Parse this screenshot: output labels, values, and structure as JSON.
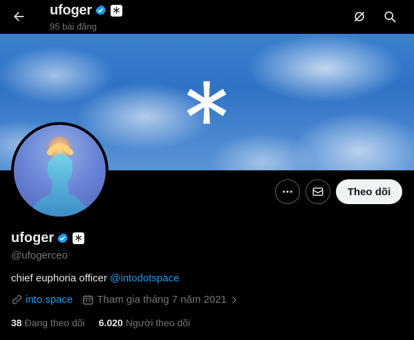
{
  "header": {
    "name": "ufoger",
    "post_count": "95 bài đăng",
    "icons": [
      "back-arrow-icon",
      "grok-icon",
      "search-icon"
    ]
  },
  "banner": {
    "colors": {
      "sky": "#2f73c6",
      "cloud": "#ffffff"
    }
  },
  "actions": {
    "more_icon": "more-icon",
    "message_icon": "envelope-icon",
    "follow_label": "Theo dõi"
  },
  "profile": {
    "name": "ufoger",
    "handle": "@ufogerceo",
    "bio_text": "chief euphoria officer ",
    "bio_mention": "@intodotspace",
    "website": "into.space",
    "joined": "Tham gia tháng 7 năm 2021",
    "following_count": "38",
    "following_label": "Đang theo dõi",
    "followers_count": "6.020",
    "followers_label": "Người theo dõi"
  },
  "colors": {
    "accent": "#1d9bf0",
    "secondary_text": "#71767b",
    "primary_text": "#e7e9ea"
  }
}
